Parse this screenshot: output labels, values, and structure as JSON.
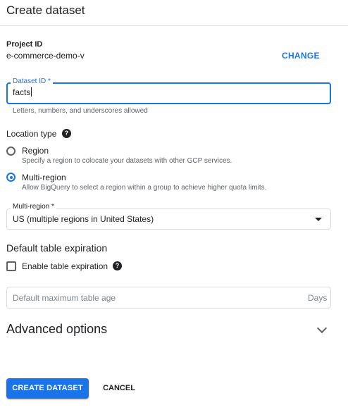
{
  "header": {
    "title": "Create dataset"
  },
  "project": {
    "label": "Project ID",
    "value": "e-commerce-demo-v",
    "change_label": "CHANGE"
  },
  "dataset_id": {
    "label": "Dataset ID *",
    "value": "facts",
    "hint": "Letters, numbers, and underscores allowed"
  },
  "location": {
    "label": "Location type",
    "help_icon": "help-icon",
    "options": [
      {
        "label": "Region",
        "description": "Specify a region to colocate your datasets with other GCP services.",
        "selected": false
      },
      {
        "label": "Multi-region",
        "description": "Allow BigQuery to select a region within a group to achieve higher quota limits.",
        "selected": true
      }
    ]
  },
  "multi_region": {
    "label": "Multi-region *",
    "value": "US (multiple regions in United States)"
  },
  "expiration": {
    "title": "Default table expiration",
    "checkbox_label": "Enable table expiration",
    "checked": false,
    "age_placeholder": "Default maximum table age",
    "age_suffix": "Days"
  },
  "advanced": {
    "title": "Advanced options",
    "icon": "chevron-down-icon"
  },
  "actions": {
    "create_label": "CREATE DATASET",
    "cancel_label": "CANCEL"
  },
  "colors": {
    "accent": "#1a73e8",
    "text": "#202124",
    "muted": "#5f6368",
    "border": "#dadce0"
  }
}
